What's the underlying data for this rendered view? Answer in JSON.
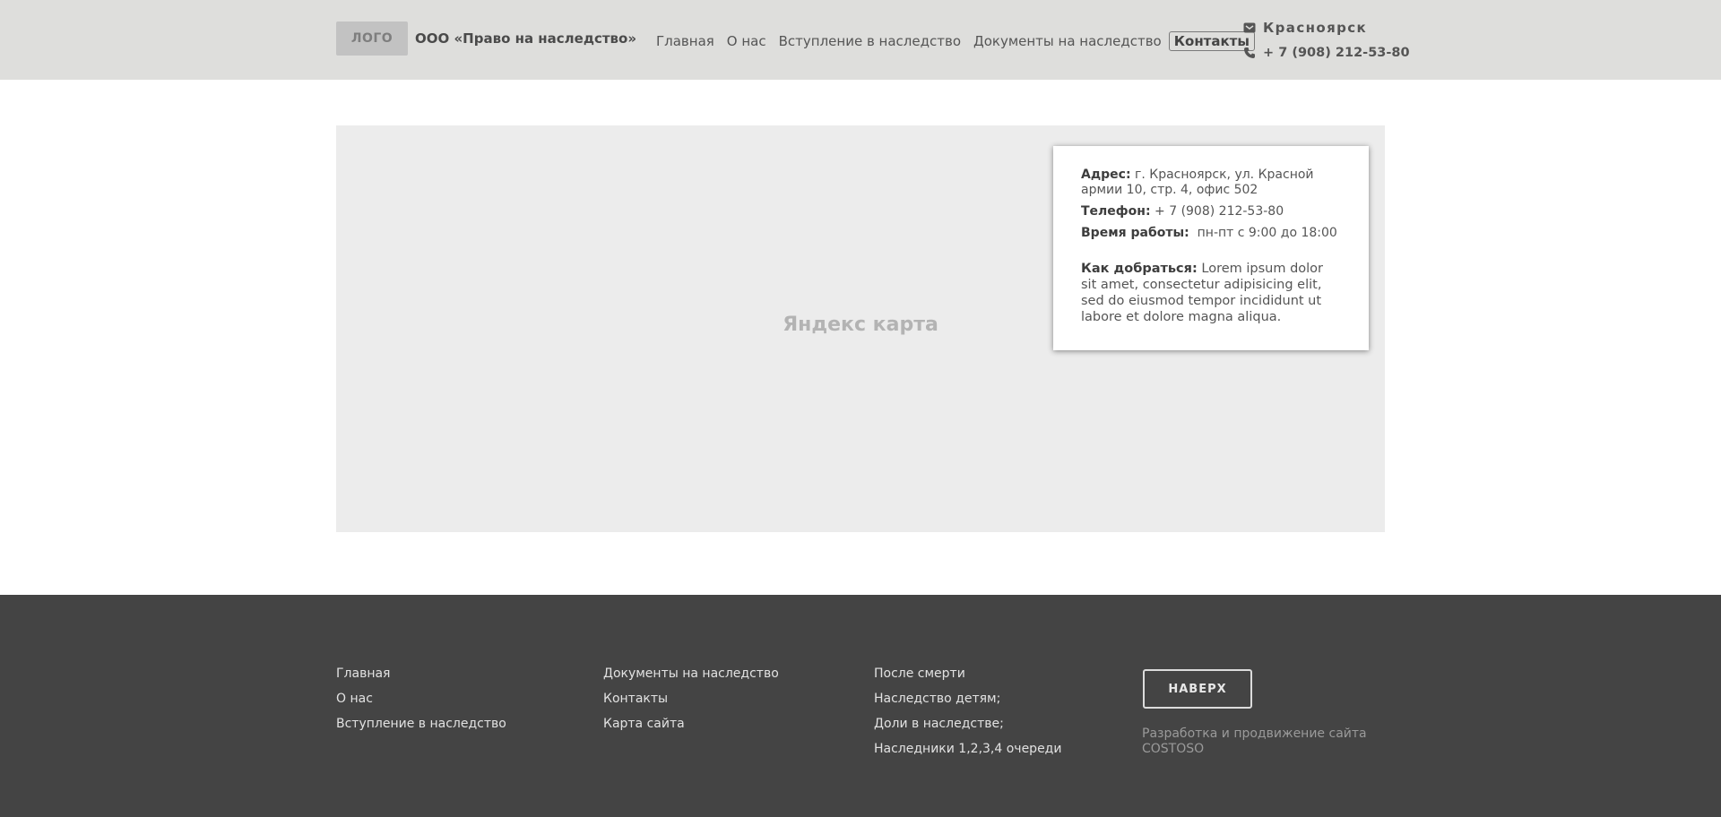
{
  "header": {
    "logo": "ЛОГО",
    "company": "ООО «Право на наследство»",
    "nav": [
      "Главная",
      "О нас",
      "Вступление в наследство",
      "Документы на наследство",
      "Контакты"
    ],
    "city": "Красноярск",
    "phone": "+ 7 (908) 212-53-80"
  },
  "map": {
    "label": "Яндекс карта",
    "card": {
      "address_label": "Адрес:",
      "address": " г. Красноярск, ул. Красной армии 10, стр. 4, офис 502",
      "phone_label": "Телефон:",
      "phone": " + 7 (908) 212-53-80",
      "hours_label": "Время работы:",
      "hours": "  пн-пт с 9:00 до 18:00",
      "howto_label": "Как добраться:",
      "howto": " Lorem ipsum dolor sit amet, consectetur adipisicing elit, sed do eiusmod tempor incididunt ut labore et dolore magna aliqua."
    }
  },
  "footer": {
    "col1": [
      "Главная",
      "О нас",
      "Вступление в наследство"
    ],
    "col2": [
      "Документы на наследство",
      "Контакты",
      "Карта сайта"
    ],
    "col3": [
      "После смерти",
      "Наследство детям;",
      "Доли в наследстве;",
      "Наследники 1,2,3,4 очереди"
    ],
    "up_button": "НАВЕРХ",
    "developer": "Разработка и продвижение сайта COSTOSO"
  }
}
